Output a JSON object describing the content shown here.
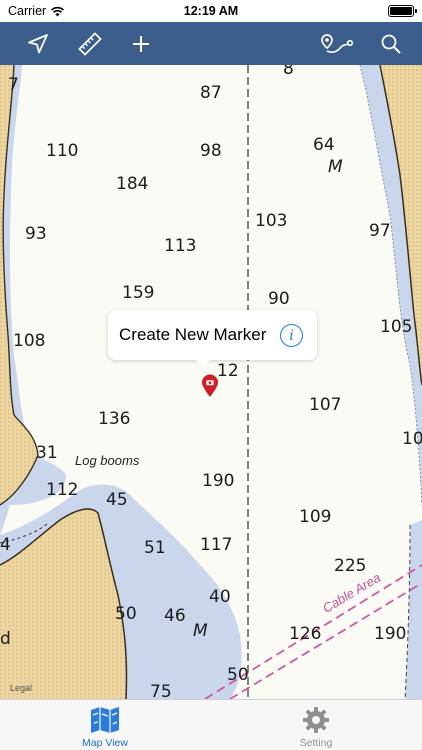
{
  "status_bar": {
    "carrier": "Carrier",
    "time": "12:19 AM"
  },
  "toolbar": {
    "buttons": [
      "location-arrow-icon",
      "ruler-icon",
      "plus-icon",
      "route-icon",
      "search-icon"
    ],
    "color": "#3c5e8d"
  },
  "map": {
    "soundings": [
      {
        "t": "87"
      },
      {
        "t": "110"
      },
      {
        "t": "98"
      },
      {
        "t": "184"
      },
      {
        "t": "64"
      },
      {
        "t": "M"
      },
      {
        "t": "93"
      },
      {
        "t": "113"
      },
      {
        "t": "103"
      },
      {
        "t": "97"
      },
      {
        "t": "159"
      },
      {
        "t": "90"
      },
      {
        "t": "108"
      },
      {
        "t": "105"
      },
      {
        "t": "12"
      },
      {
        "t": "136"
      },
      {
        "t": "107"
      },
      {
        "t": "10"
      },
      {
        "t": "31"
      },
      {
        "t": "112"
      },
      {
        "t": "45"
      },
      {
        "t": "190"
      },
      {
        "t": "109"
      },
      {
        "t": "51"
      },
      {
        "t": "117"
      },
      {
        "t": "225"
      },
      {
        "t": "4"
      },
      {
        "t": "40"
      },
      {
        "t": "50"
      },
      {
        "t": "46"
      },
      {
        "t": "M"
      },
      {
        "t": "126"
      },
      {
        "t": "190"
      },
      {
        "t": "d"
      },
      {
        "t": "75"
      },
      {
        "t": "50"
      },
      {
        "t": "7"
      },
      {
        "t": "8"
      }
    ],
    "labels": {
      "log_booms": "Log booms",
      "cable_area": "Cable Area",
      "legal": "Legal"
    },
    "colors": {
      "water_shallow": "#c9d6eb",
      "land": "#efd59f",
      "sea": "#fbfbf6"
    }
  },
  "callout": {
    "title": "Create New Marker",
    "info_glyph": "i"
  },
  "tabbar": {
    "tabs": [
      {
        "label": "Map View",
        "active": true
      },
      {
        "label": "Setting",
        "active": false
      }
    ],
    "active_color": "#1d6fd6",
    "inactive_color": "#8e8e93"
  }
}
